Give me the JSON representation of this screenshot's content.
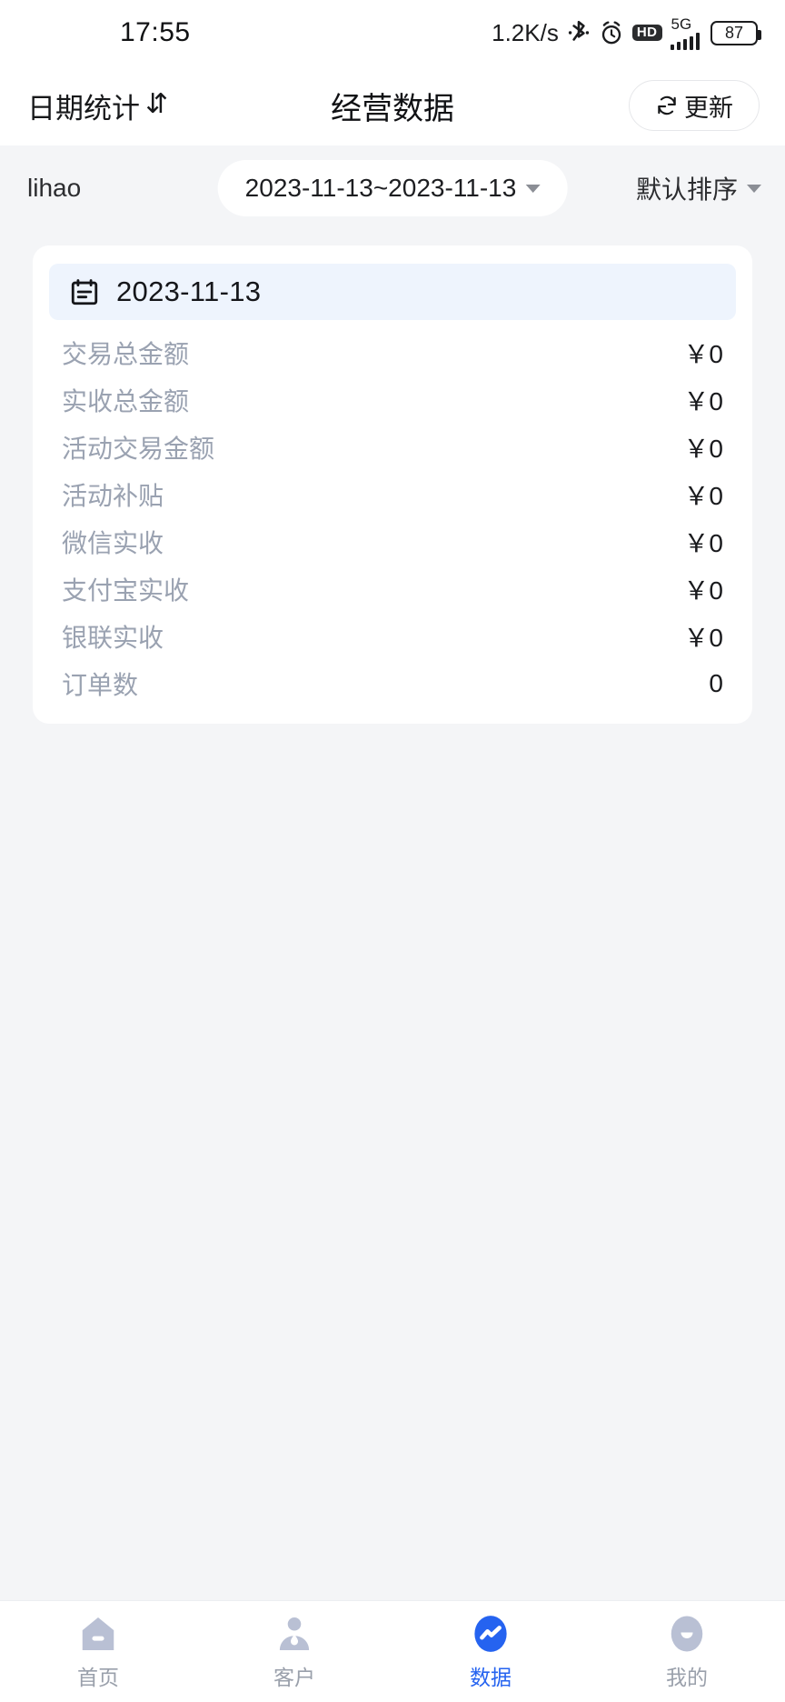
{
  "status_bar": {
    "time": "17:55",
    "net_speed": "1.2K/s",
    "bluetooth_icon": "bluetooth-icon",
    "alarm_icon": "alarm-icon",
    "hd_label": "HD",
    "network_type": "5G",
    "battery_level": "87"
  },
  "header": {
    "left_label": "日期统计",
    "sort_swap_icon": "sort-swap-icon",
    "title": "经营数据",
    "refresh_label": "更新",
    "refresh_icon": "refresh-icon"
  },
  "filter_bar": {
    "shop_name": "lihao",
    "date_range": "2023-11-13~2023-11-13",
    "date_caret_icon": "chevron-down-icon",
    "sort_label": "默认排序",
    "sort_caret_icon": "chevron-down-icon"
  },
  "card": {
    "date_icon": "calendar-icon",
    "date": "2023-11-13",
    "rows": [
      {
        "label": "交易总金额",
        "value": "￥0"
      },
      {
        "label": "实收总金额",
        "value": "￥0"
      },
      {
        "label": "活动交易金额",
        "value": "￥0"
      },
      {
        "label": "活动补贴",
        "value": "￥0"
      },
      {
        "label": "微信实收",
        "value": "￥0"
      },
      {
        "label": "支付宝实收",
        "value": "￥0"
      },
      {
        "label": "银联实收",
        "value": "￥0"
      },
      {
        "label": "订单数",
        "value": "0"
      }
    ]
  },
  "bottom_nav": {
    "items": [
      {
        "label": "首页",
        "icon": "home-icon",
        "active": false
      },
      {
        "label": "客户",
        "icon": "user-icon",
        "active": false
      },
      {
        "label": "数据",
        "icon": "chart-icon",
        "active": true
      },
      {
        "label": "我的",
        "icon": "profile-icon",
        "active": false
      }
    ]
  },
  "colors": {
    "accent": "#2563f0",
    "page_bg": "#f4f5f7",
    "card_bg": "#ffffff",
    "date_head_bg": "#eef4fd",
    "label_gray": "#9aa2b1",
    "nav_inactive": "#b9c0d4"
  }
}
